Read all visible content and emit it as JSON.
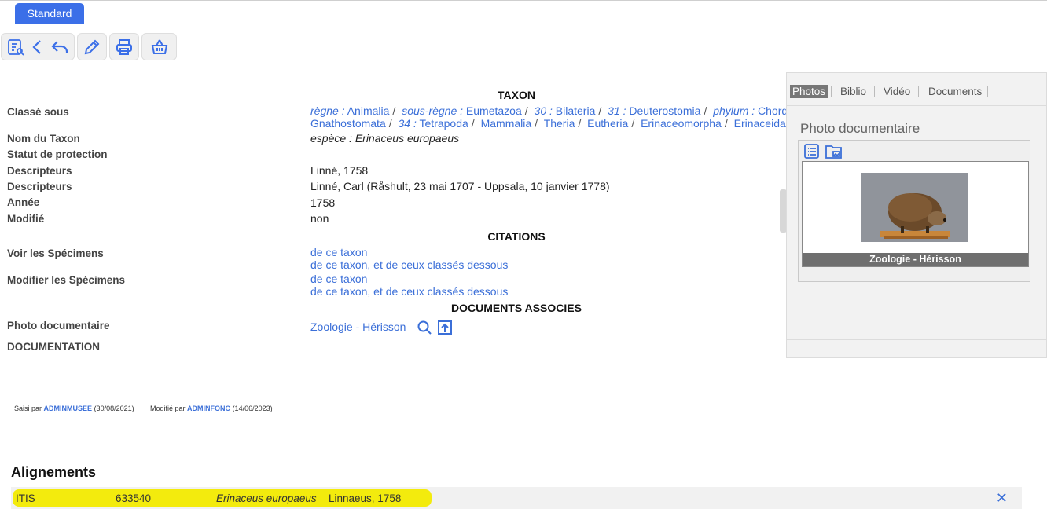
{
  "tab": {
    "label": "Standard"
  },
  "sections": {
    "taxon": "TAXON",
    "citations": "CITATIONS",
    "documents": "DOCUMENTS ASSOCIES"
  },
  "labels": {
    "classe_sous": "Classé sous",
    "nom_taxon": "Nom du Taxon",
    "statut": "Statut de protection",
    "descripteurs1": "Descripteurs",
    "descripteurs2": "Descripteurs",
    "annee": "Année",
    "modifie": "Modifié",
    "voir_specimens": "Voir les Spécimens",
    "modifier_specimens": "Modifier les Spécimens",
    "photo_doc": "Photo documentaire",
    "documentation": "DOCUMENTATION"
  },
  "breadcrumb": {
    "row1": [
      {
        "rank": "règne :",
        "name": "Animalia"
      },
      {
        "rank": "sous-règne :",
        "name": "Eumetazoa"
      },
      {
        "rank": "30 :",
        "name": "Bilateria"
      },
      {
        "rank": "31 :",
        "name": "Deuterostomia"
      },
      {
        "rank": "phylum :",
        "name": "Chordata"
      }
    ],
    "row2": [
      {
        "rank": "",
        "name": "Gnathostomata"
      },
      {
        "rank": "34 :",
        "name": "Tetrapoda"
      },
      {
        "rank": "",
        "name": "Mammalia"
      },
      {
        "rank": "",
        "name": "Theria"
      },
      {
        "rank": "",
        "name": "Eutheria"
      },
      {
        "rank": "",
        "name": "Erinaceomorpha"
      },
      {
        "rank": "",
        "name": "Erinaceidae"
      }
    ]
  },
  "values": {
    "nom_taxon": "espèce : Erinaceus europaeus",
    "descripteurs1": "Linné, 1758",
    "descripteurs2": "Linné, Carl (Råshult, 23 mai 1707 - Uppsala, 10 janvier 1778)",
    "annee": "1758",
    "modifie": "non",
    "voir1": "de ce taxon",
    "voir2": "de ce taxon, et de ceux classés dessous",
    "modif1": "de ce taxon",
    "modif2": "de ce taxon, et de ceux classés dessous",
    "photo_link": "Zoologie - Hérisson"
  },
  "meta": {
    "saisi_prefix": "Saisi par",
    "saisi_user": "ADMINMUSEE",
    "saisi_date": "(30/08/2021)",
    "modif_prefix": "Modifié par",
    "modif_user": "ADMINFONC",
    "modif_date": "(14/06/2023)"
  },
  "alignements": {
    "title": "Alignements",
    "source": "ITIS",
    "id": "633540",
    "name": "Erinaceus europaeus",
    "author": "Linnaeus, 1758"
  },
  "panel": {
    "tabs": [
      "Photos",
      "Biblio",
      "Vidéo",
      "Documents"
    ],
    "active_tab": "Photos",
    "heading": "Photo documentaire",
    "caption": "Zoologie - Hérisson"
  },
  "colors": {
    "accent": "#3b6fe8",
    "link": "#3b6fd8",
    "highlight": "#f2ea00"
  },
  "icons": [
    "list-search-icon",
    "chevron-left-icon",
    "undo-icon",
    "pencil-icon",
    "printer-icon",
    "basket-icon",
    "search-icon",
    "open-external-icon",
    "list-view-icon",
    "folder-image-icon",
    "close-icon"
  ]
}
